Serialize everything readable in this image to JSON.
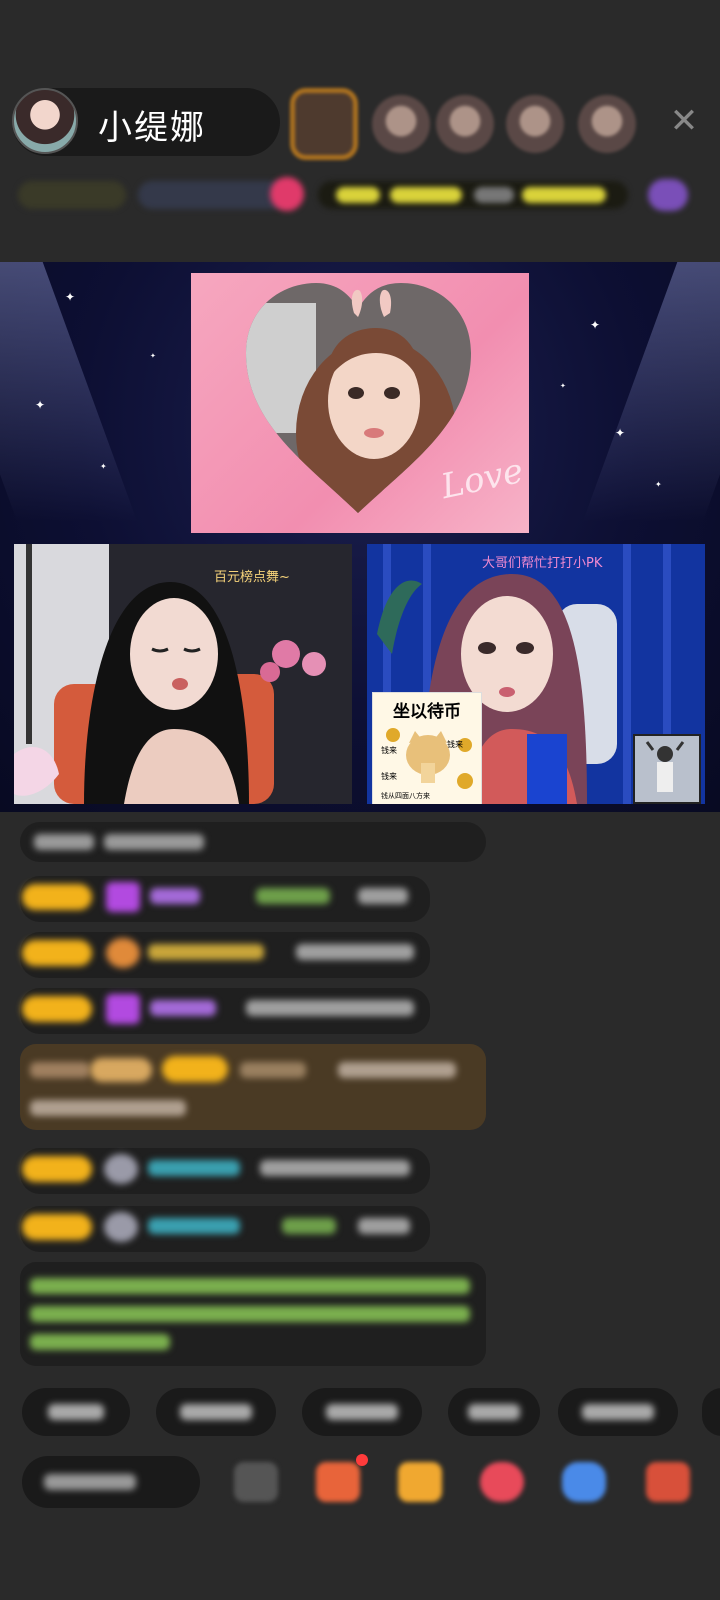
{
  "header": {
    "host_name": "小缇娜",
    "close_glyph": "✕"
  },
  "stage": {
    "love_text": "Love",
    "left_caption": "百元榜点舞~",
    "right_caption": "大哥们帮忙打打小PK",
    "sticker_title": "坐以待币",
    "sticker_lines": [
      "钱来",
      "钱来",
      "钱来",
      "钱从四面八方来"
    ]
  },
  "colors": {
    "badge": "#f2b21b",
    "left_caption": "#f6d37a",
    "right_caption": "#f18ad0",
    "purple_gem": "#b24ae0",
    "highlight_msg": "#9ed06b"
  },
  "icons": [
    "close-icon",
    "gem-icon",
    "shield-icon",
    "gift-icon",
    "more-icon"
  ]
}
